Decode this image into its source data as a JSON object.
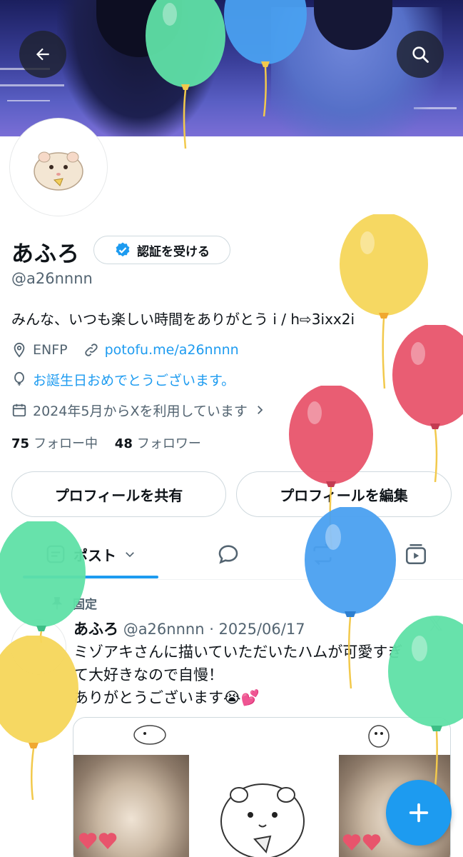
{
  "banner": {
    "back_icon": "arrow-left-icon",
    "search_icon": "search-icon"
  },
  "profile": {
    "display_name": "あふろ",
    "verify_button": "認証を受ける",
    "handle": "@a26nnnn",
    "bio": "みんな、いつも楽しい時間をありがとう i / h⇨3ixx2i",
    "location": "ENFP",
    "link": "potofu.me/a26nnnn",
    "birthday_text": "お誕生日おめでとうございます。",
    "joined": "2024年5月からXを利用しています",
    "following_count": "75",
    "following_label": "フォロー中",
    "followers_count": "48",
    "followers_label": "フォロワー",
    "share_button": "プロフィールを共有",
    "edit_button": "プロフィールを編集"
  },
  "tabs": {
    "posts_label": "ポスト",
    "icons": [
      "post-icon",
      "reply-icon",
      "repost-icon",
      "video-icon"
    ]
  },
  "post": {
    "pinned_label": "固定",
    "author": "あふろ",
    "meta": "@a26nnnn · 2025/06/17",
    "line1": "ミゾアキさんに描いていただいたハムが可愛すぎ",
    "line2": "て大好きなので自慢！",
    "line3": "ありがとうございます😭💕"
  },
  "colors": {
    "accent": "#1d9bf0",
    "text": "#0f1419",
    "secondary": "#536471",
    "balloon_green": "#5fe0a6",
    "balloon_blue": "#4aa0f0",
    "balloon_yellow": "#f5d65a",
    "balloon_red": "#e8546c"
  }
}
